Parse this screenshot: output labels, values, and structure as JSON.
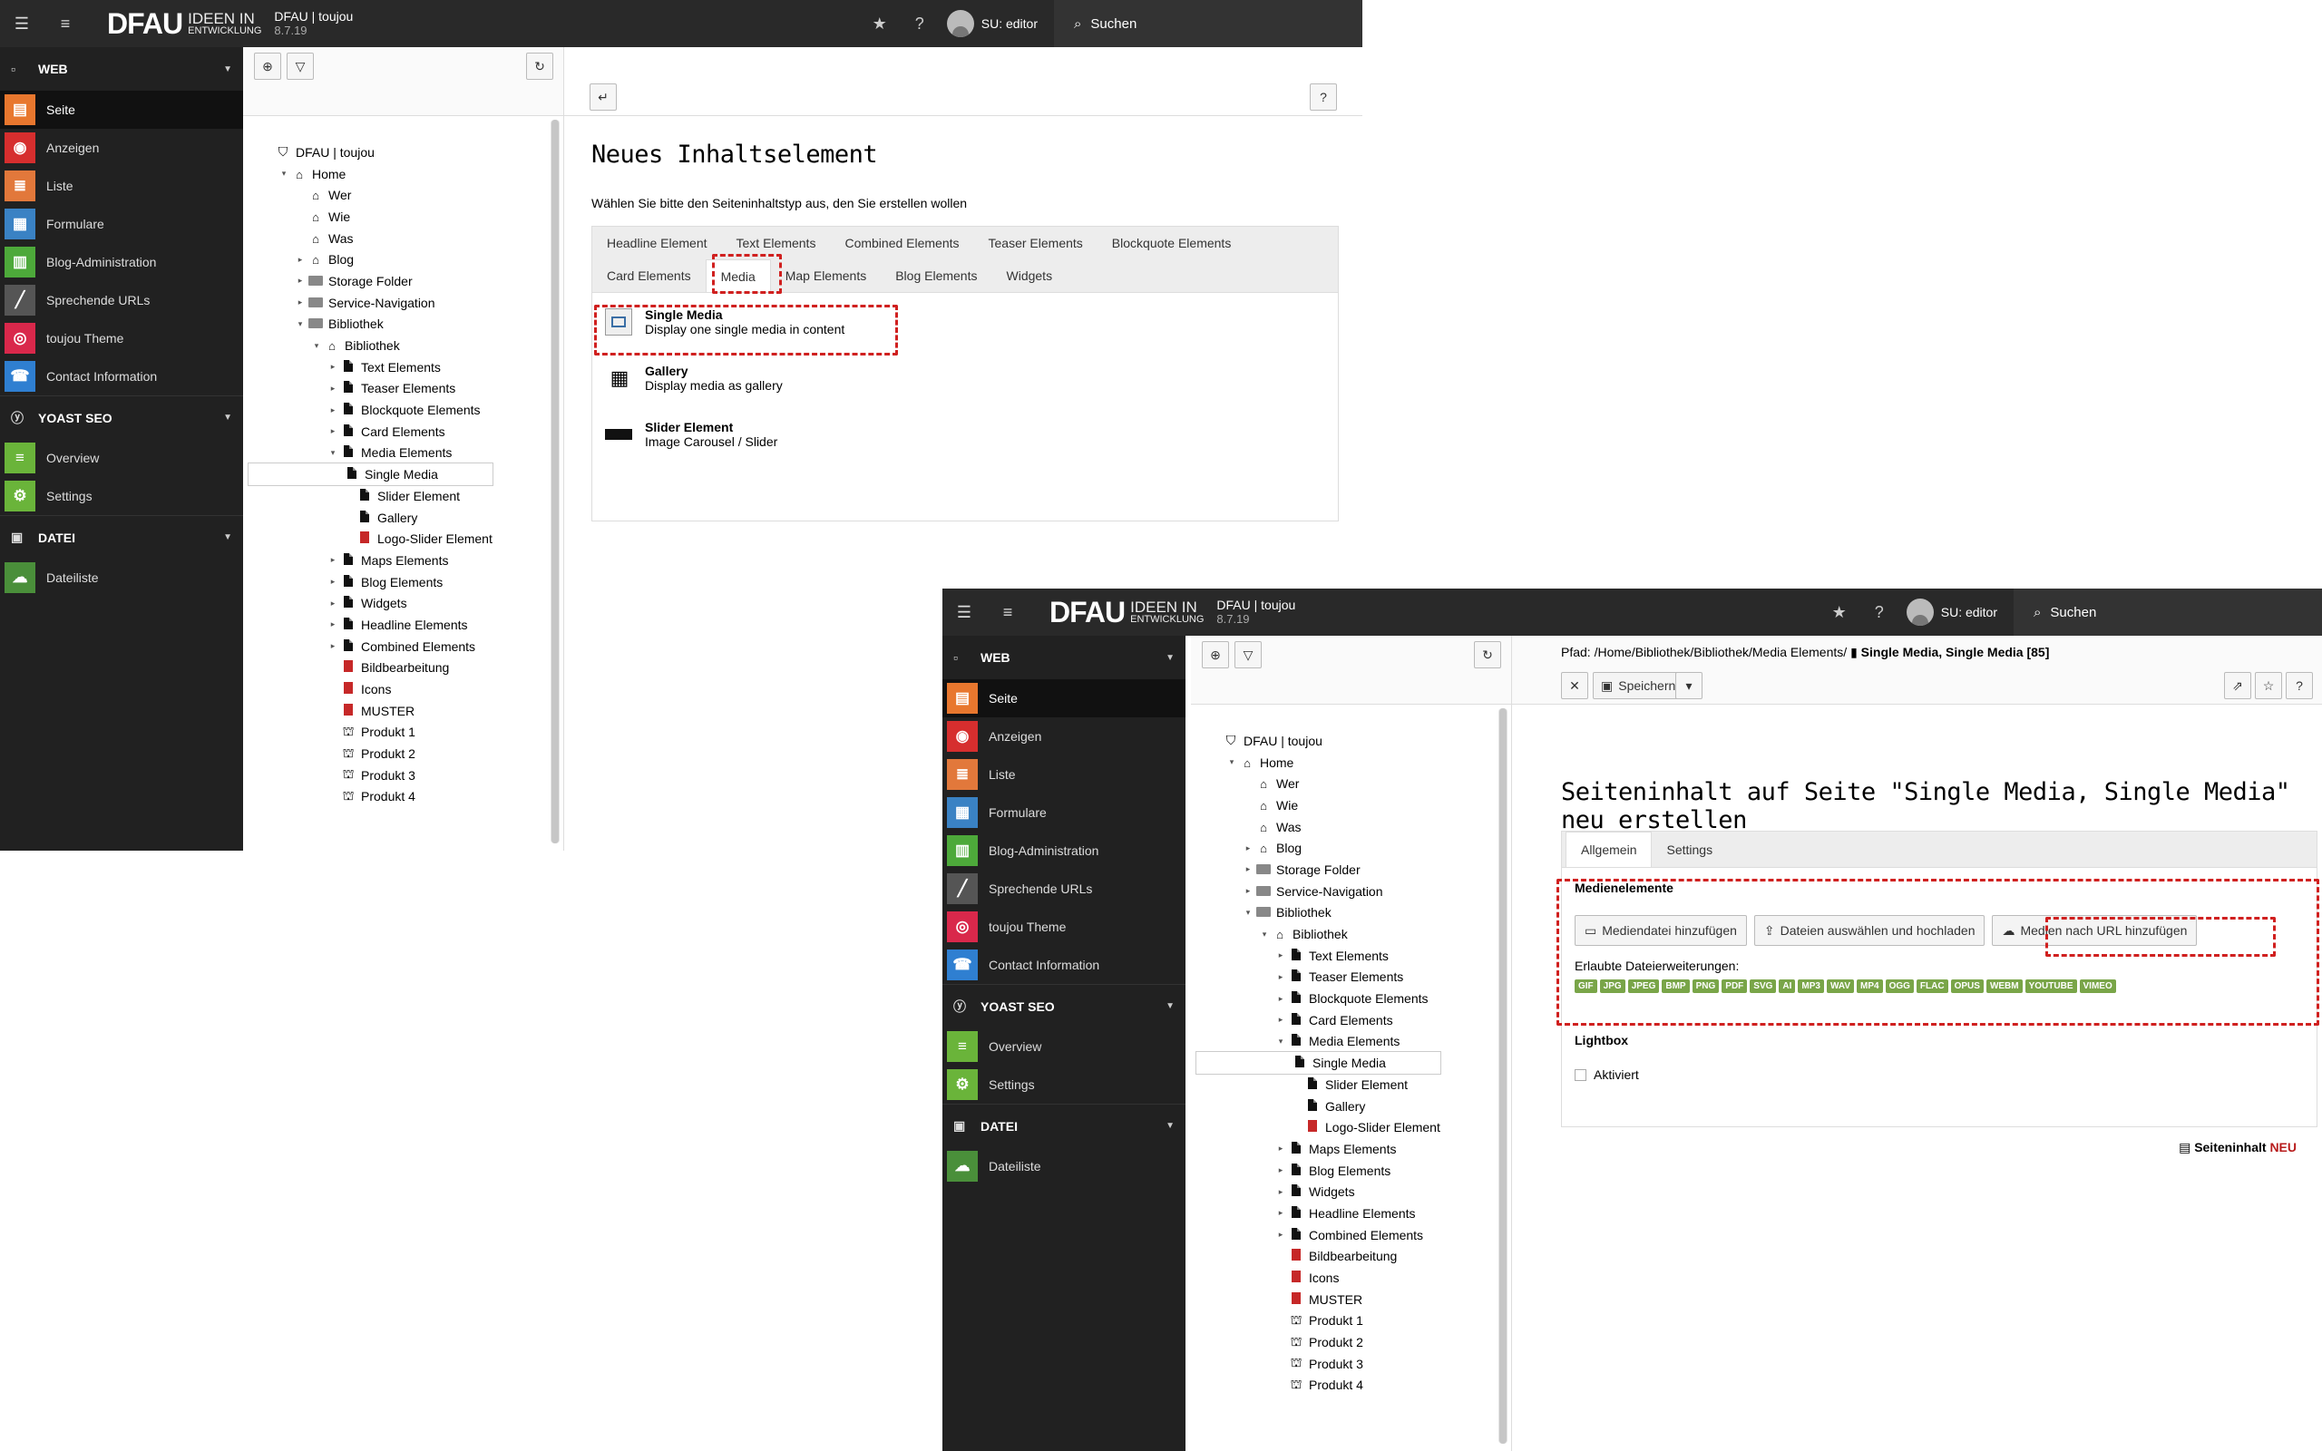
{
  "app": {
    "logo_main": "DFAU",
    "logo_sub_top": "IDEEN IN",
    "logo_sub_bottom": "ENTWICKLUNG",
    "site_name": "DFAU | toujou",
    "version": "8.7.19",
    "user": "SU: editor",
    "search": "Suchen"
  },
  "modules": {
    "web": "WEB",
    "web_items": [
      "Seite",
      "Anzeigen",
      "Liste",
      "Formulare",
      "Blog-Administration",
      "Sprechende URLs",
      "toujou Theme",
      "Contact Information"
    ],
    "yoast": "YOAST SEO",
    "yoast_items": [
      "Overview",
      "Settings"
    ],
    "datei": "DATEI",
    "datei_items": [
      "Dateiliste"
    ]
  },
  "tree": {
    "root": "DFAU | toujou",
    "nodes": [
      "Home",
      "Wer",
      "Wie",
      "Was",
      "Blog",
      "Storage Folder",
      "Service-Navigation",
      "Bibliothek",
      "Bibliothek",
      "Text Elements",
      "Teaser Elements",
      "Blockquote Elements",
      "Card Elements",
      "Media Elements",
      "Single Media",
      "Slider Element",
      "Gallery",
      "Logo-Slider Element",
      "Maps Elements",
      "Blog Elements",
      "Widgets",
      "Headline Elements",
      "Combined Elements",
      "Bildbearbeitung",
      "Icons",
      "MUSTER",
      "Produkt 1",
      "Produkt 2",
      "Produkt 3",
      "Produkt 4"
    ]
  },
  "wizard": {
    "title": "Neues Inhaltselement",
    "intro": "Wählen Sie bitte den Seiteninhaltstyp aus, den Sie erstellen wollen",
    "tabs_row1": [
      "Headline Element",
      "Text Elements",
      "Combined Elements",
      "Teaser Elements",
      "Blockquote Elements"
    ],
    "tabs_row2": [
      "Card Elements",
      "Media",
      "Map Elements",
      "Blog Elements",
      "Widgets"
    ],
    "elements": [
      {
        "title": "Single Media",
        "desc": "Display one single media in content"
      },
      {
        "title": "Gallery",
        "desc": "Display media as gallery"
      },
      {
        "title": "Slider Element",
        "desc": "Image Carousel / Slider"
      }
    ]
  },
  "editor": {
    "path_label": "Pfad: /Home/Bibliothek/Bibliothek/Media Elements/",
    "path_page": "Single Media, Single Media [85]",
    "save": "Speichern",
    "title": "Seiteninhalt auf Seite \"Single Media, Single Media\" neu erstellen",
    "tabs": [
      "Allgemein",
      "Settings"
    ],
    "media_heading": "Medienelemente",
    "btn_add_file": "Mediendatei hinzufügen",
    "btn_upload": "Dateien auswählen und hochladen",
    "btn_url": "Medien nach URL hinzufügen",
    "allowed_label": "Erlaubte Dateierweiterungen:",
    "extensions": [
      "GIF",
      "JPG",
      "JPEG",
      "BMP",
      "PNG",
      "PDF",
      "SVG",
      "AI",
      "MP3",
      "WAV",
      "MP4",
      "OGG",
      "FLAC",
      "OPUS",
      "WEBM",
      "YOUTUBE",
      "VIMEO"
    ],
    "lightbox": "Lightbox",
    "lightbox_check": "Aktiviert",
    "footer_label": "Seiteninhalt",
    "footer_new": "NEU"
  },
  "colors": {
    "seite": "#e8772e",
    "anzeigen": "#d62e2e",
    "liste": "#e2783b",
    "formulare": "#3a82c4",
    "blog": "#4da93a",
    "urls": "#555555",
    "theme": "#d9284b",
    "contact": "#2f7fd1",
    "yoast_overview": "#6ab43a",
    "yoast_settings": "#6ab43a",
    "dateiliste": "#4a8f3a",
    "badge": "#79a548",
    "dash": "#d0201f"
  }
}
